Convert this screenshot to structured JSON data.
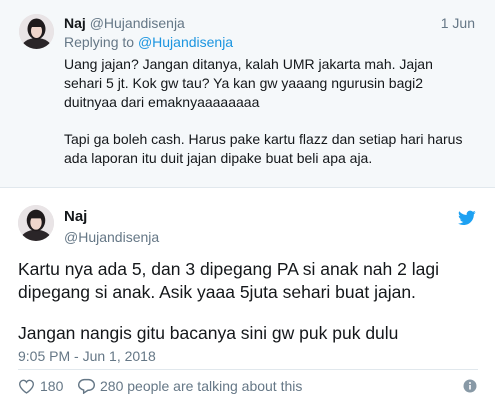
{
  "reply_tweet": {
    "name": "Naj",
    "handle": "@Hujandisenja",
    "date": "1 Jun",
    "replying_prefix": "Replying to ",
    "replying_handle": "@Hujandisenja",
    "paragraph1": "Uang jajan? Jangan ditanya, kalah UMR jakarta mah. Jajan sehari 5 jt. Kok gw tau? Ya kan gw yaaang ngurusin bagi2 duitnyaa dari emaknyaaaaaaaa",
    "paragraph2": "Tapi ga boleh cash. Harus pake kartu flazz dan setiap hari harus ada laporan itu duit jajan dipake buat beli apa aja."
  },
  "main_tweet": {
    "name": "Naj",
    "handle": "@Hujandisenja",
    "paragraph1": "Kartu nya ada 5, dan 3 dipegang PA si anak nah 2 lagi dipegang si anak. Asik yaaa 5juta sehari buat jajan.",
    "paragraph2": "Jangan nangis gitu bacanya sini gw puk puk dulu",
    "timestamp": "9:05 PM - Jun 1, 2018",
    "likes": "180",
    "talking": "280 people are talking about this"
  },
  "colors": {
    "twitter_blue": "#1da1f2",
    "link_blue": "#1b95e0",
    "muted_gray": "#657786",
    "reply_bg": "#f5f8fa"
  },
  "icons": {
    "avatar": "profile-photo",
    "bird": "twitter-bird-icon",
    "heart": "heart-icon",
    "bubble": "speech-bubble-icon",
    "info": "info-icon"
  }
}
